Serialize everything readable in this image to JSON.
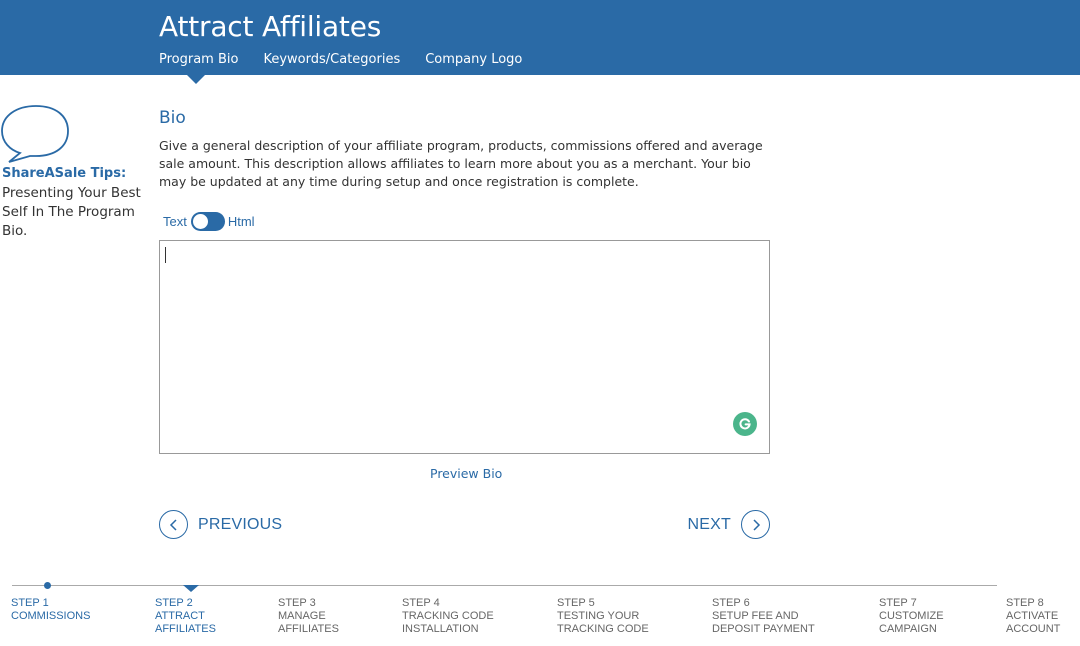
{
  "header": {
    "title": "Attract Affiliates",
    "subnav": [
      "Program Bio",
      "Keywords/Categories",
      "Company Logo"
    ]
  },
  "tips": {
    "title": "ShareASale Tips:",
    "text": "Presenting Your Best Self In The Program Bio."
  },
  "main": {
    "section_title": "Bio",
    "description": "Give a general description of your affiliate program, products, commissions offered and average sale amount. This description allows affiliates to learn more about you as a merchant. Your bio may be updated at any time during setup and once registration is complete.",
    "toggle": {
      "left_label": "Text",
      "right_label": "Html"
    },
    "bio_value": "",
    "preview_link": "Preview Bio",
    "previous_label": "PREVIOUS",
    "next_label": "NEXT"
  },
  "steps": [
    {
      "num": "STEP 1",
      "label": "COMMISSIONS",
      "state": "done"
    },
    {
      "num": "STEP 2",
      "label": "ATTRACT AFFILIATES",
      "state": "active"
    },
    {
      "num": "STEP 3",
      "label": "MANAGE AFFILIATES",
      "state": "todo"
    },
    {
      "num": "STEP 4",
      "label": "TRACKING CODE INSTALLATION",
      "state": "todo"
    },
    {
      "num": "STEP 5",
      "label": "TESTING YOUR TRACKING CODE",
      "state": "todo"
    },
    {
      "num": "STEP 6",
      "label": "SETUP FEE AND DEPOSIT PAYMENT",
      "state": "todo"
    },
    {
      "num": "STEP 7",
      "label": "CUSTOMIZE CAMPAIGN",
      "state": "todo"
    },
    {
      "num": "STEP 8",
      "label": "ACTIVATE ACCOUNT",
      "state": "todo"
    }
  ],
  "colors": {
    "brand": "#2a6aa6",
    "grammarly": "#4bb58b"
  }
}
